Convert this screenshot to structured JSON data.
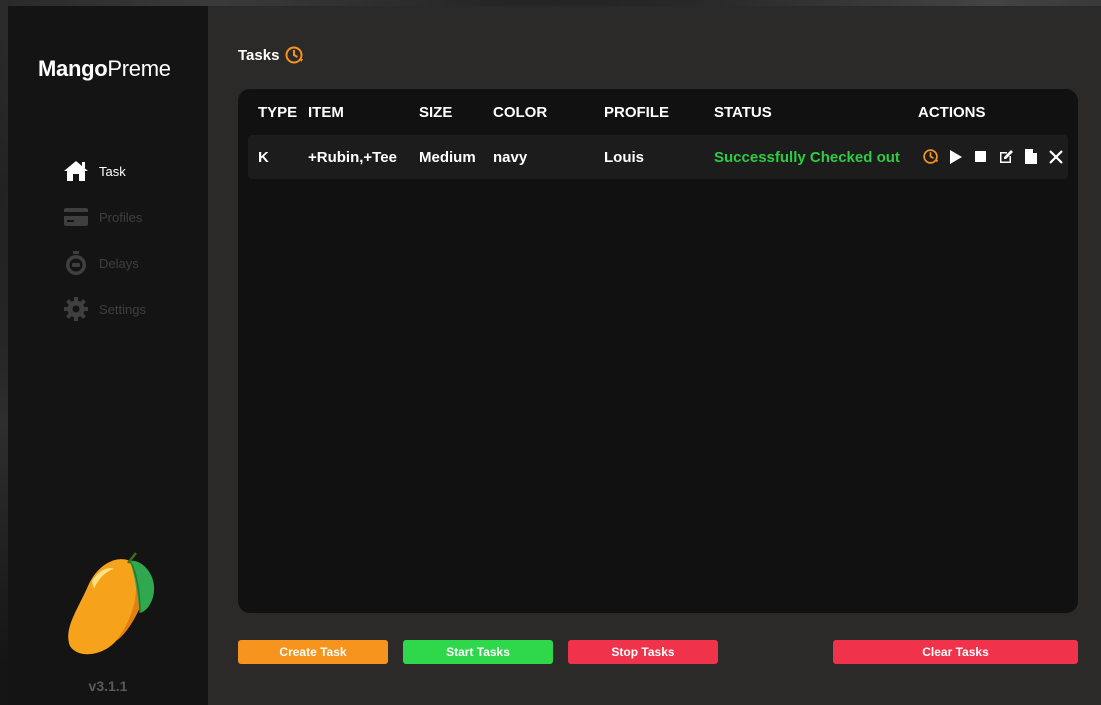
{
  "brand": {
    "bold": "Mango",
    "light": "Preme"
  },
  "sidebar": {
    "items": [
      {
        "label": "Task",
        "icon": "home-icon",
        "active": true
      },
      {
        "label": "Profiles",
        "icon": "credit-card-icon",
        "active": false
      },
      {
        "label": "Delays",
        "icon": "stopwatch-icon",
        "active": false
      },
      {
        "label": "Settings",
        "icon": "gear-icon",
        "active": false
      }
    ],
    "version": "v3.1.1",
    "logo": "mango-logo"
  },
  "header": {
    "title": "Tasks",
    "icon": "clock-refresh-icon"
  },
  "table": {
    "columns": [
      "TYPE",
      "ITEM",
      "SIZE",
      "COLOR",
      "PROFILE",
      "STATUS",
      "ACTIONS"
    ],
    "rows": [
      {
        "type": "K",
        "item": "+Rubin,+Tee",
        "size": "Medium",
        "color": "navy",
        "profile": "Louis",
        "status": "Successfully Checked out",
        "actions": [
          "clock-refresh-icon",
          "play-icon",
          "stop-icon",
          "edit-icon",
          "file-icon",
          "close-icon"
        ]
      }
    ]
  },
  "buttons": {
    "create": "Create Task",
    "start": "Start Tasks",
    "stop": "Stop Tasks",
    "clear": "Clear Tasks"
  },
  "colors": {
    "orange": "#f7941d",
    "green": "#2ecc40",
    "red": "#f0324a",
    "status_green": "#2ecc40"
  }
}
